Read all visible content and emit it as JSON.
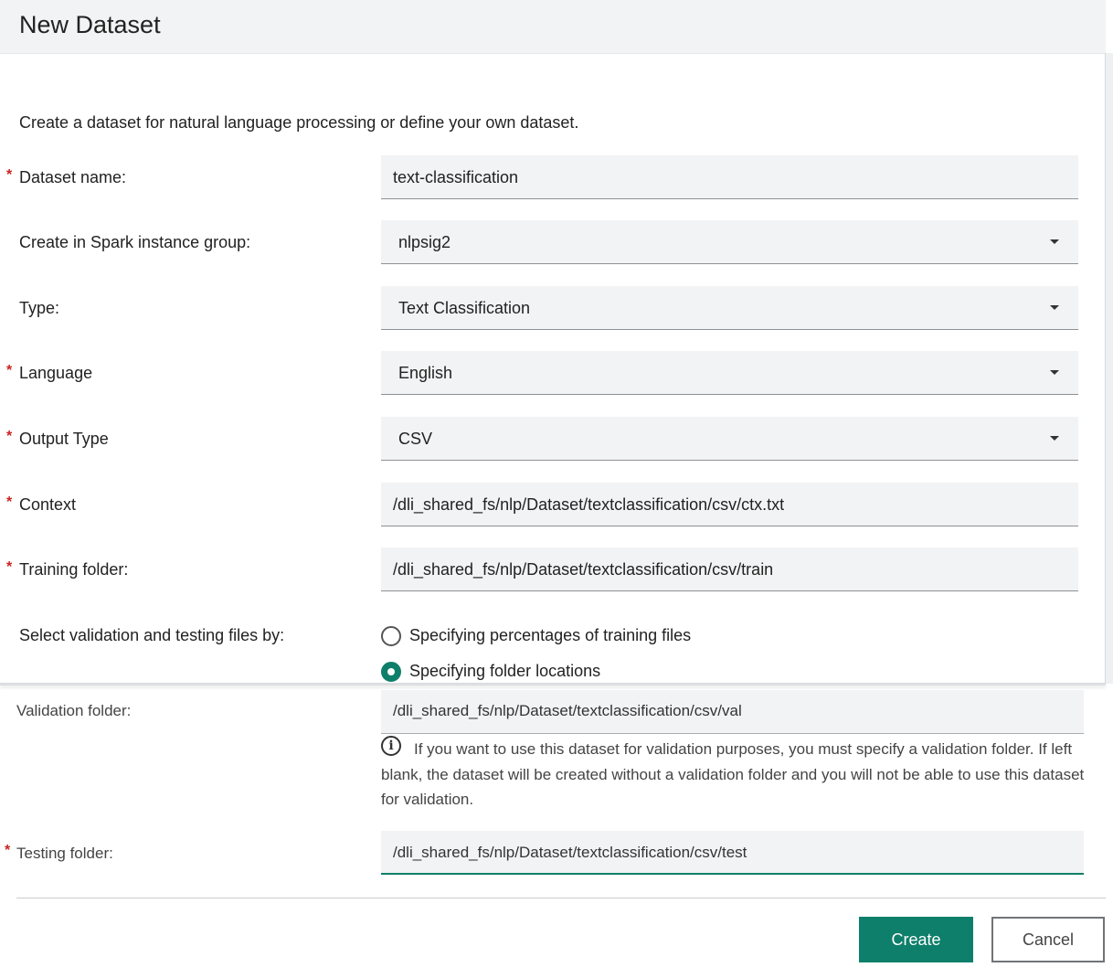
{
  "dialog": {
    "title": "New Dataset",
    "intro": "Create a dataset for natural language processing or define your own dataset."
  },
  "form": {
    "required_marker": "*",
    "dataset_name": {
      "label": "Dataset name:",
      "value": "text-classification"
    },
    "spark_group": {
      "label": "Create in Spark instance group:",
      "value": "nlpsig2"
    },
    "type": {
      "label": "Type:",
      "value": "Text Classification"
    },
    "language": {
      "label": "Language",
      "value": "English"
    },
    "output_type": {
      "label": "Output Type",
      "value": "CSV"
    },
    "context": {
      "label": "Context",
      "value": "/dli_shared_fs/nlp/Dataset/textclassification/csv/ctx.txt"
    },
    "training_folder": {
      "label": "Training folder:",
      "value": "/dli_shared_fs/nlp/Dataset/textclassification/csv/train"
    },
    "select_by": {
      "label": "Select validation and testing files by:",
      "options": [
        "Specifying percentages of training files",
        "Specifying folder locations"
      ],
      "selected": "Specifying folder locations"
    },
    "validation_folder": {
      "label": "Validation folder:",
      "value": "/dli_shared_fs/nlp/Dataset/textclassification/csv/val"
    },
    "validation_info": "If you want to use this dataset for validation purposes, you must specify a validation folder. If left blank, the dataset will be created without a validation folder and you will not be able to use this dataset for validation.",
    "testing_folder": {
      "label": "Testing folder:",
      "value": "/dli_shared_fs/nlp/Dataset/textclassification/csv/test"
    }
  },
  "buttons": {
    "create": "Create",
    "cancel": "Cancel"
  },
  "colors": {
    "accent": "#0e7f6a",
    "required": "#cc2222",
    "field_bg": "#f2f3f4",
    "header_bg": "#f2f3f4"
  },
  "icons": {
    "dropdown": "caret-down-icon",
    "info": "info-icon",
    "radio": "radio-icon"
  }
}
